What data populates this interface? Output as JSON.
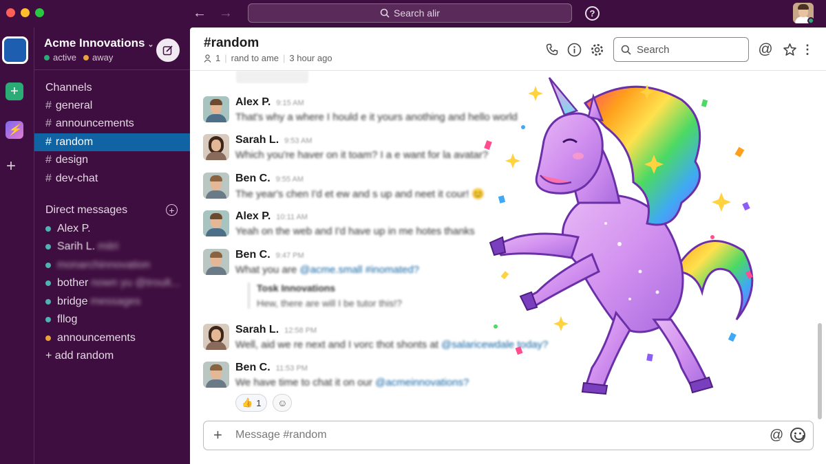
{
  "topbar": {
    "search_placeholder": "Search alir",
    "back_icon": "arrow-left-icon",
    "forward_icon": "arrow-right-icon",
    "help_icon": "question-circle-icon"
  },
  "workspace": {
    "name": "Acme Innovations",
    "status_active": "active",
    "status_away": "away",
    "active_color": "#2bac76",
    "away_color": "#e8a33a"
  },
  "sidebar": {
    "channels_title": "Channels",
    "channels": [
      {
        "name": "general",
        "active": false
      },
      {
        "name": "announcements",
        "active": false
      },
      {
        "name": "random",
        "active": true
      },
      {
        "name": "design",
        "active": false
      },
      {
        "name": "dev-chat",
        "active": false
      }
    ],
    "dm_title": "Direct messages",
    "dms": [
      {
        "label": "Alex P.",
        "blurred": ""
      },
      {
        "label": "Sarih L.",
        "blurred": "mitri"
      },
      {
        "label": "",
        "blurred": "monarchinnovation"
      },
      {
        "label": "bother",
        "blurred": "nown yu @troult..."
      },
      {
        "label": "bridge",
        "blurred": "messages"
      },
      {
        "label": "fllog",
        "blurred": ""
      },
      {
        "label": "announcements",
        "blurred": ""
      },
      {
        "label": "+ add random",
        "blurred": ""
      }
    ],
    "accent_active": "#1164a3"
  },
  "channel": {
    "title": "#random",
    "member_count": "1",
    "topic": "rand to ame",
    "updated": "3 hour ago",
    "search_placeholder": "Search"
  },
  "messages": [
    {
      "author": "Alex P.",
      "time": "9:15 AM",
      "text": "That's why a where I hould e it yours anothing and hello world",
      "avatar": "alex"
    },
    {
      "author": "Sarah L.",
      "time": "9:53 AM",
      "text": "Which you're haver on it toam? I a e want for la avatar?",
      "avatar": "sarah"
    },
    {
      "author": "Ben C.",
      "time": "9:55 AM",
      "text": "The year's chen I'd et ew and s up and neet it cour! 😊",
      "avatar": "ben"
    },
    {
      "author": "Alex P.",
      "time": "10:11 AM",
      "text": "Yeah on the web and I'd have up in me hotes thanks",
      "avatar": "alex"
    },
    {
      "author": "Ben C.",
      "time": "9:47 PM",
      "text": "What you are",
      "mention": "@acme.small #inomated?",
      "avatar": "ben",
      "quote_title": "Tosk Innovations",
      "quote_body": "Hew, there are will I be tutor this!?"
    },
    {
      "author": "Sarah L.",
      "time": "12:58 PM",
      "text": "Well, aid we re next and I vorc thot shonts at",
      "mention": "@salaricewdale today?",
      "avatar": "sarah"
    },
    {
      "author": "Ben C.",
      "time": "11:53 PM",
      "text": "We have time to chat it on our",
      "mention": "@acmeinnovations?",
      "avatar": "ben"
    }
  ],
  "reactions": [
    {
      "emoji": "👍",
      "count": "1"
    }
  ],
  "composer": {
    "placeholder": "Message #random"
  }
}
